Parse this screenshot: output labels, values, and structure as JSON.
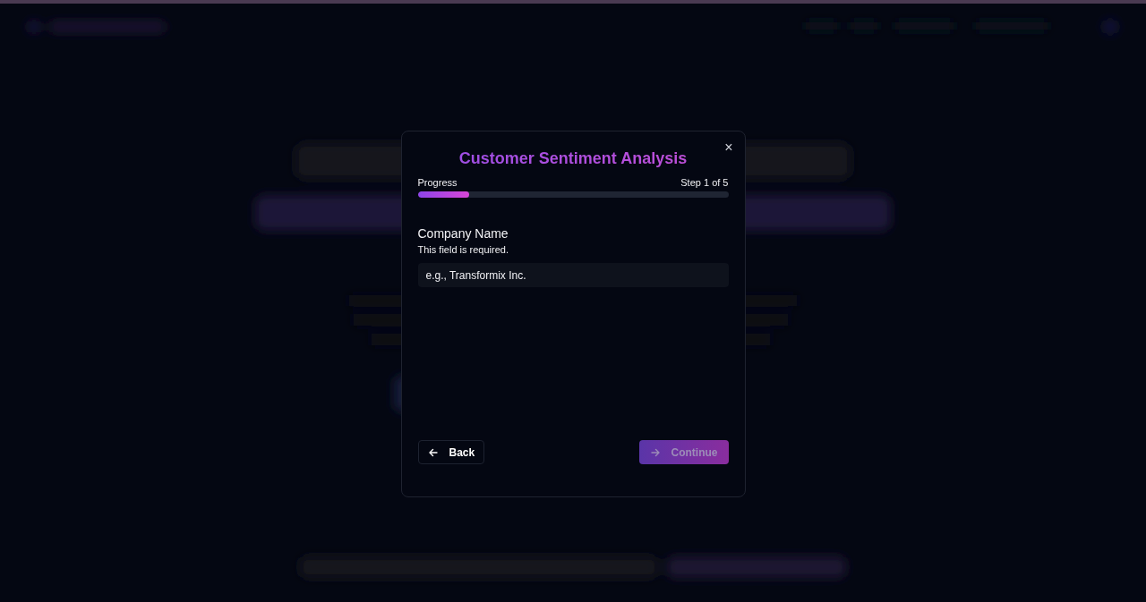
{
  "dialog": {
    "title": "Customer Sentiment Analysis",
    "close": "×",
    "progress": {
      "label": "Progress",
      "step": "Step 1 of 5",
      "level": 0.165
    },
    "field": {
      "label": "Company Name",
      "hint": "This field is required.",
      "placeholder": "e.g., Transformix Inc."
    },
    "buttons": [
      {
        "kind": "back",
        "label": "Back",
        "disabled": false
      },
      {
        "kind": "continue",
        "label": "Continue",
        "disabled": true
      }
    ]
  }
}
